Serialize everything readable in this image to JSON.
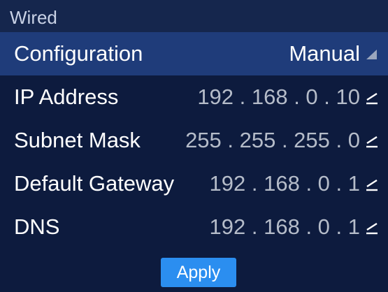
{
  "header": {
    "title": "Wired"
  },
  "rows": [
    {
      "label": "Configuration",
      "value": "Manual",
      "icon": "dropdown-triangle-icon"
    },
    {
      "label": "IP Address",
      "value": "192 . 168 . 0 . 10",
      "icon": "edit-icon"
    },
    {
      "label": "Subnet Mask",
      "value": "255 . 255 . 255 . 0",
      "icon": "edit-icon"
    },
    {
      "label": "Default Gateway",
      "value": "192 . 168 . 0 . 1",
      "icon": "edit-icon"
    },
    {
      "label": "DNS",
      "value": "192 . 168 . 0 . 1",
      "icon": "edit-icon"
    }
  ],
  "apply_label": "Apply",
  "colors": {
    "background": "#0d1b3e",
    "header": "#15264d",
    "selected_row": "#1f3c7a",
    "button": "#2b8ef0"
  }
}
